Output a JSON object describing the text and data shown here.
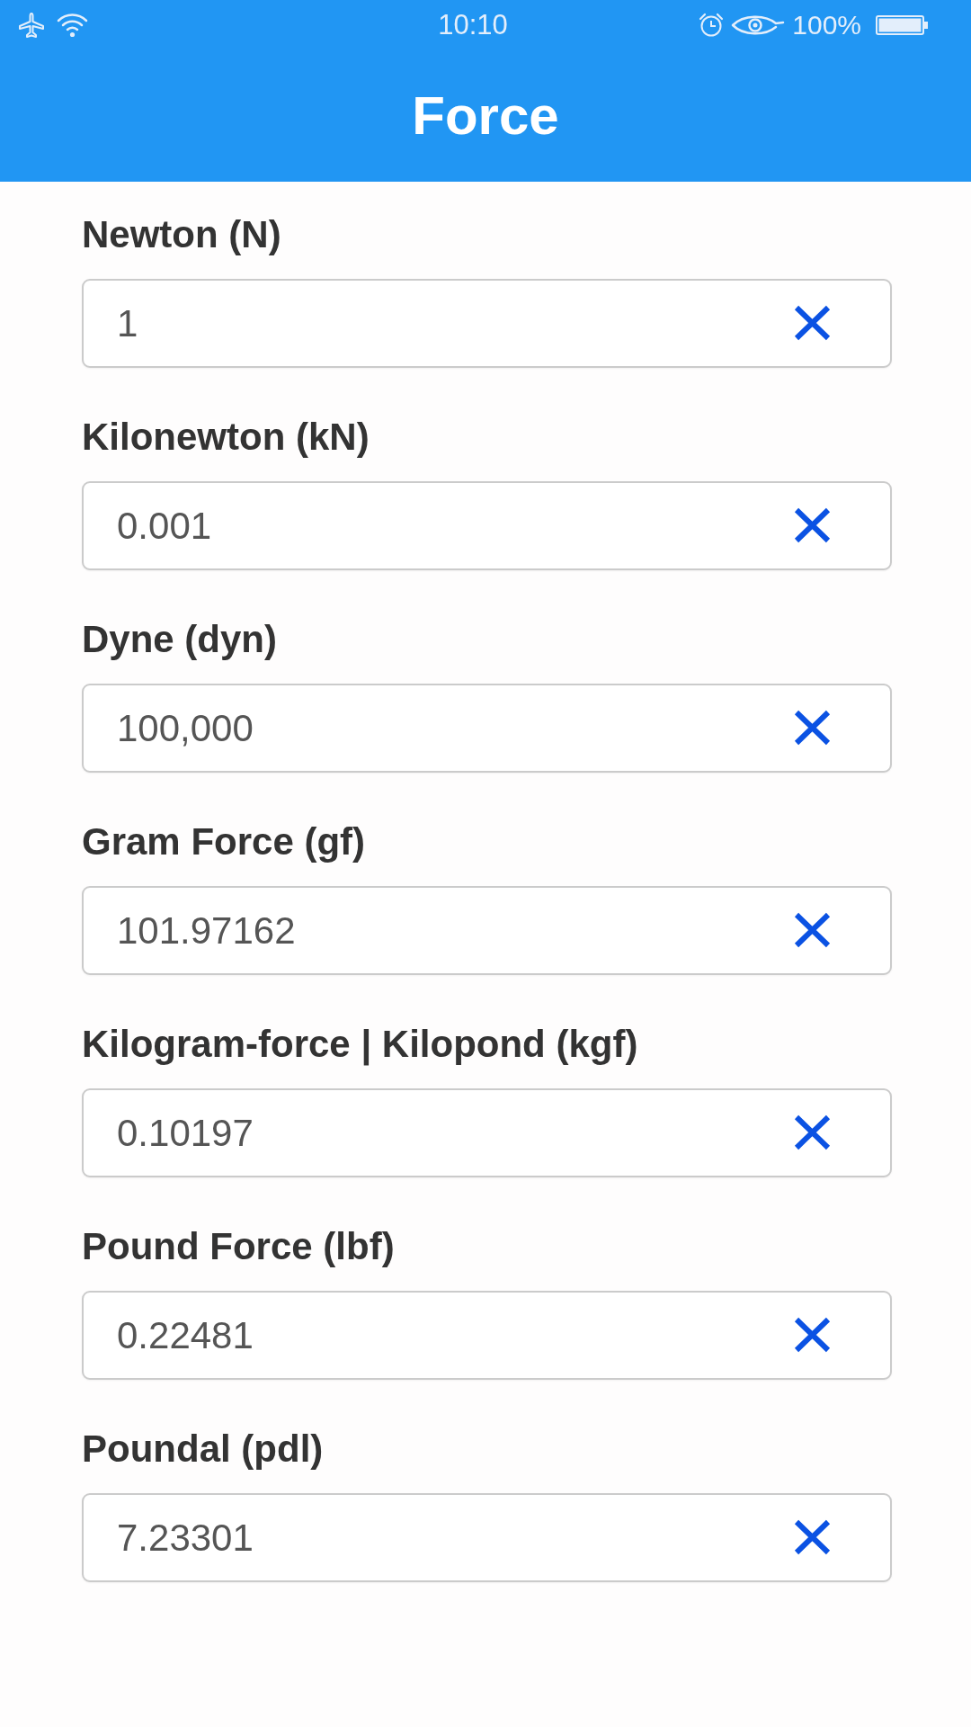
{
  "status_bar": {
    "time": "10:10",
    "battery": "100%"
  },
  "app_bar": {
    "title": "Force"
  },
  "units": [
    {
      "label": "Newton (N)",
      "value": "1"
    },
    {
      "label": "Kilonewton (kN)",
      "value": "0.001"
    },
    {
      "label": "Dyne (dyn)",
      "value": "100,000"
    },
    {
      "label": "Gram Force (gf)",
      "value": "101.97162"
    },
    {
      "label": "Kilogram-force | Kilopond (kgf)",
      "value": "0.10197"
    },
    {
      "label": "Pound Force (lbf)",
      "value": "0.22481"
    },
    {
      "label": "Poundal (pdl)",
      "value": "7.23301"
    }
  ]
}
